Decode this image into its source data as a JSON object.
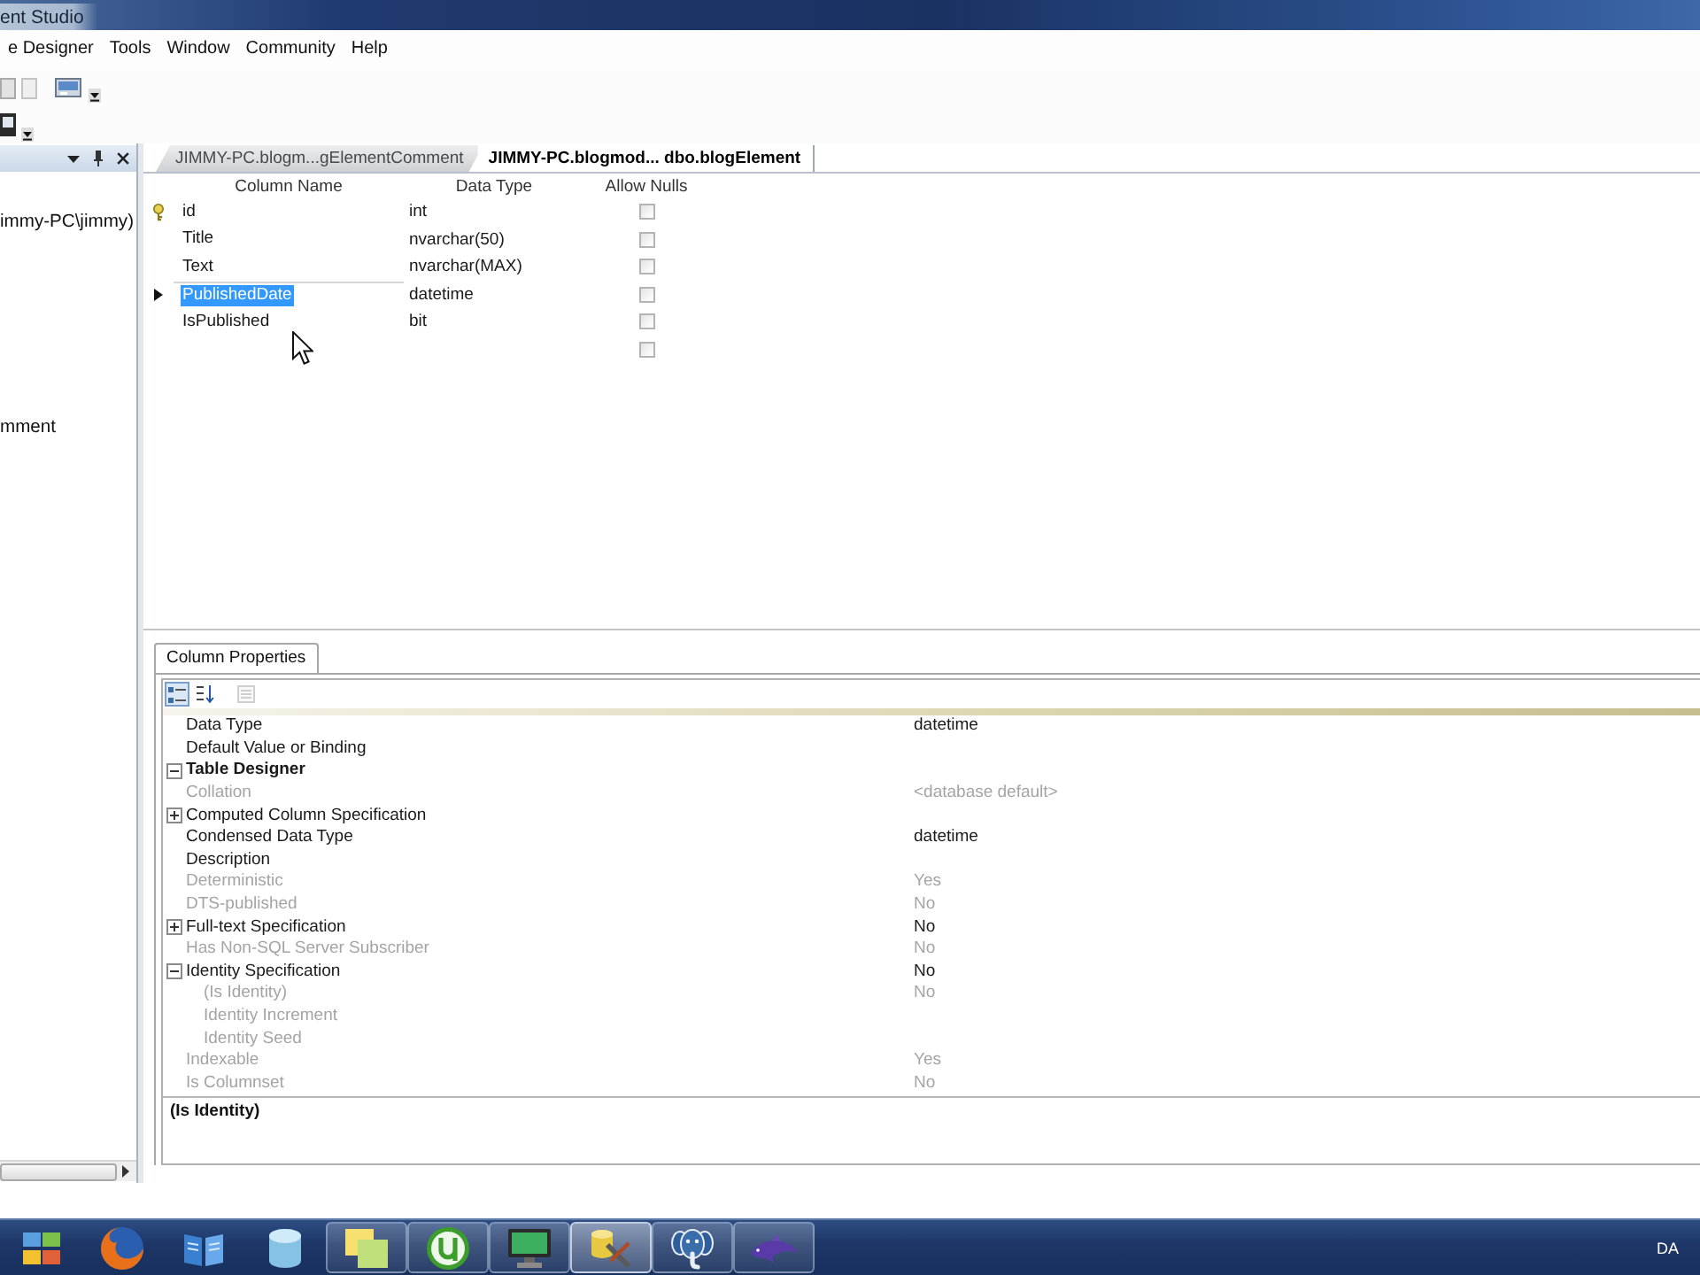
{
  "window": {
    "title": "ent Studio"
  },
  "menu": [
    "e Designer",
    "Tools",
    "Window",
    "Community",
    "Help"
  ],
  "explorer": {
    "items": [
      {
        "label": "immy-PC\\jimmy)",
        "selected": false
      },
      {
        "label": "mment",
        "selected": false
      }
    ]
  },
  "document_tabs": [
    {
      "label": "JIMMY-PC.blogm...gElementComment",
      "selected": false
    },
    {
      "label": "JIMMY-PC.blogmod... dbo.blogElement",
      "selected": true
    }
  ],
  "table": {
    "columns": [
      "Column Name",
      "Data Type",
      "Allow Nulls"
    ],
    "rows": [
      {
        "name": "id",
        "data_type": "int",
        "allow_nulls": false,
        "primary_key": true,
        "selected": false
      },
      {
        "name": "Title",
        "data_type": "nvarchar(50)",
        "allow_nulls": false,
        "primary_key": false,
        "selected": false
      },
      {
        "name": "Text",
        "data_type": "nvarchar(MAX)",
        "allow_nulls": false,
        "primary_key": false,
        "selected": false
      },
      {
        "name": "PublishedDate",
        "data_type": "datetime",
        "allow_nulls": false,
        "primary_key": false,
        "selected": true
      },
      {
        "name": "IsPublished",
        "data_type": "bit",
        "allow_nulls": false,
        "primary_key": false,
        "selected": false
      },
      {
        "allow_nulls": false,
        "primary_key": false,
        "selected": false
      }
    ]
  },
  "properties": {
    "tab": "Column Properties",
    "toolbar": [
      {
        "kind": "categorized",
        "selected": true,
        "disabled": false
      },
      {
        "kind": "alphabetical",
        "selected": false,
        "disabled": false
      },
      {
        "kind": "pages",
        "selected": false,
        "disabled": true
      }
    ],
    "rows": [
      {
        "label": "Data Type",
        "value": "datetime",
        "kind": "property",
        "disabled": false
      },
      {
        "label": "Default Value or Binding",
        "kind": "property",
        "disabled": false
      },
      {
        "label": "Table Designer",
        "kind": "category",
        "expanded": true,
        "disabled": false,
        "children": [
          {
            "label": "Collation",
            "value": "<database default>",
            "kind": "property",
            "disabled": true
          },
          {
            "label": "Computed Column Specification",
            "kind": "group",
            "expanded": false,
            "disabled": false
          },
          {
            "label": "Condensed Data Type",
            "value": "datetime",
            "kind": "property",
            "disabled": false
          },
          {
            "label": "Description",
            "kind": "property",
            "disabled": false
          },
          {
            "label": "Deterministic",
            "value": "Yes",
            "kind": "property",
            "disabled": true
          },
          {
            "label": "DTS-published",
            "value": "No",
            "kind": "property",
            "disabled": true
          },
          {
            "label": "Full-text Specification",
            "value": "No",
            "kind": "group",
            "expanded": false,
            "disabled": false
          },
          {
            "label": "Has Non-SQL Server Subscriber",
            "value": "No",
            "kind": "property",
            "disabled": true
          },
          {
            "label": "Identity Specification",
            "value": "No",
            "kind": "group",
            "expanded": true,
            "disabled": false,
            "children": [
              {
                "label": "(Is Identity)",
                "value": "No",
                "kind": "property",
                "disabled": true
              },
              {
                "label": "Identity Increment",
                "kind": "property",
                "disabled": true
              },
              {
                "label": "Identity Seed",
                "kind": "property",
                "disabled": true
              }
            ]
          },
          {
            "label": "Indexable",
            "value": "Yes",
            "kind": "property",
            "disabled": true
          },
          {
            "label": "Is Columnset",
            "value": "No",
            "kind": "property",
            "disabled": true
          }
        ]
      }
    ],
    "description": "(Is Identity)"
  },
  "taskbar": {
    "items": [
      {
        "kind": "app",
        "running": false,
        "selected": false
      },
      {
        "kind": "globe",
        "running": false,
        "selected": false
      },
      {
        "kind": "book",
        "running": false,
        "selected": false
      },
      {
        "kind": "database",
        "running": false,
        "selected": false
      },
      {
        "kind": "notes",
        "running": true,
        "selected": false
      },
      {
        "kind": "circle_logo",
        "running": true,
        "selected": false
      },
      {
        "kind": "monitor",
        "running": true,
        "selected": false
      },
      {
        "kind": "tools",
        "running": true,
        "selected": true
      },
      {
        "kind": "elephant",
        "running": true,
        "selected": false
      },
      {
        "kind": "dolphin",
        "running": true,
        "selected": false
      }
    ],
    "language": "DA"
  }
}
